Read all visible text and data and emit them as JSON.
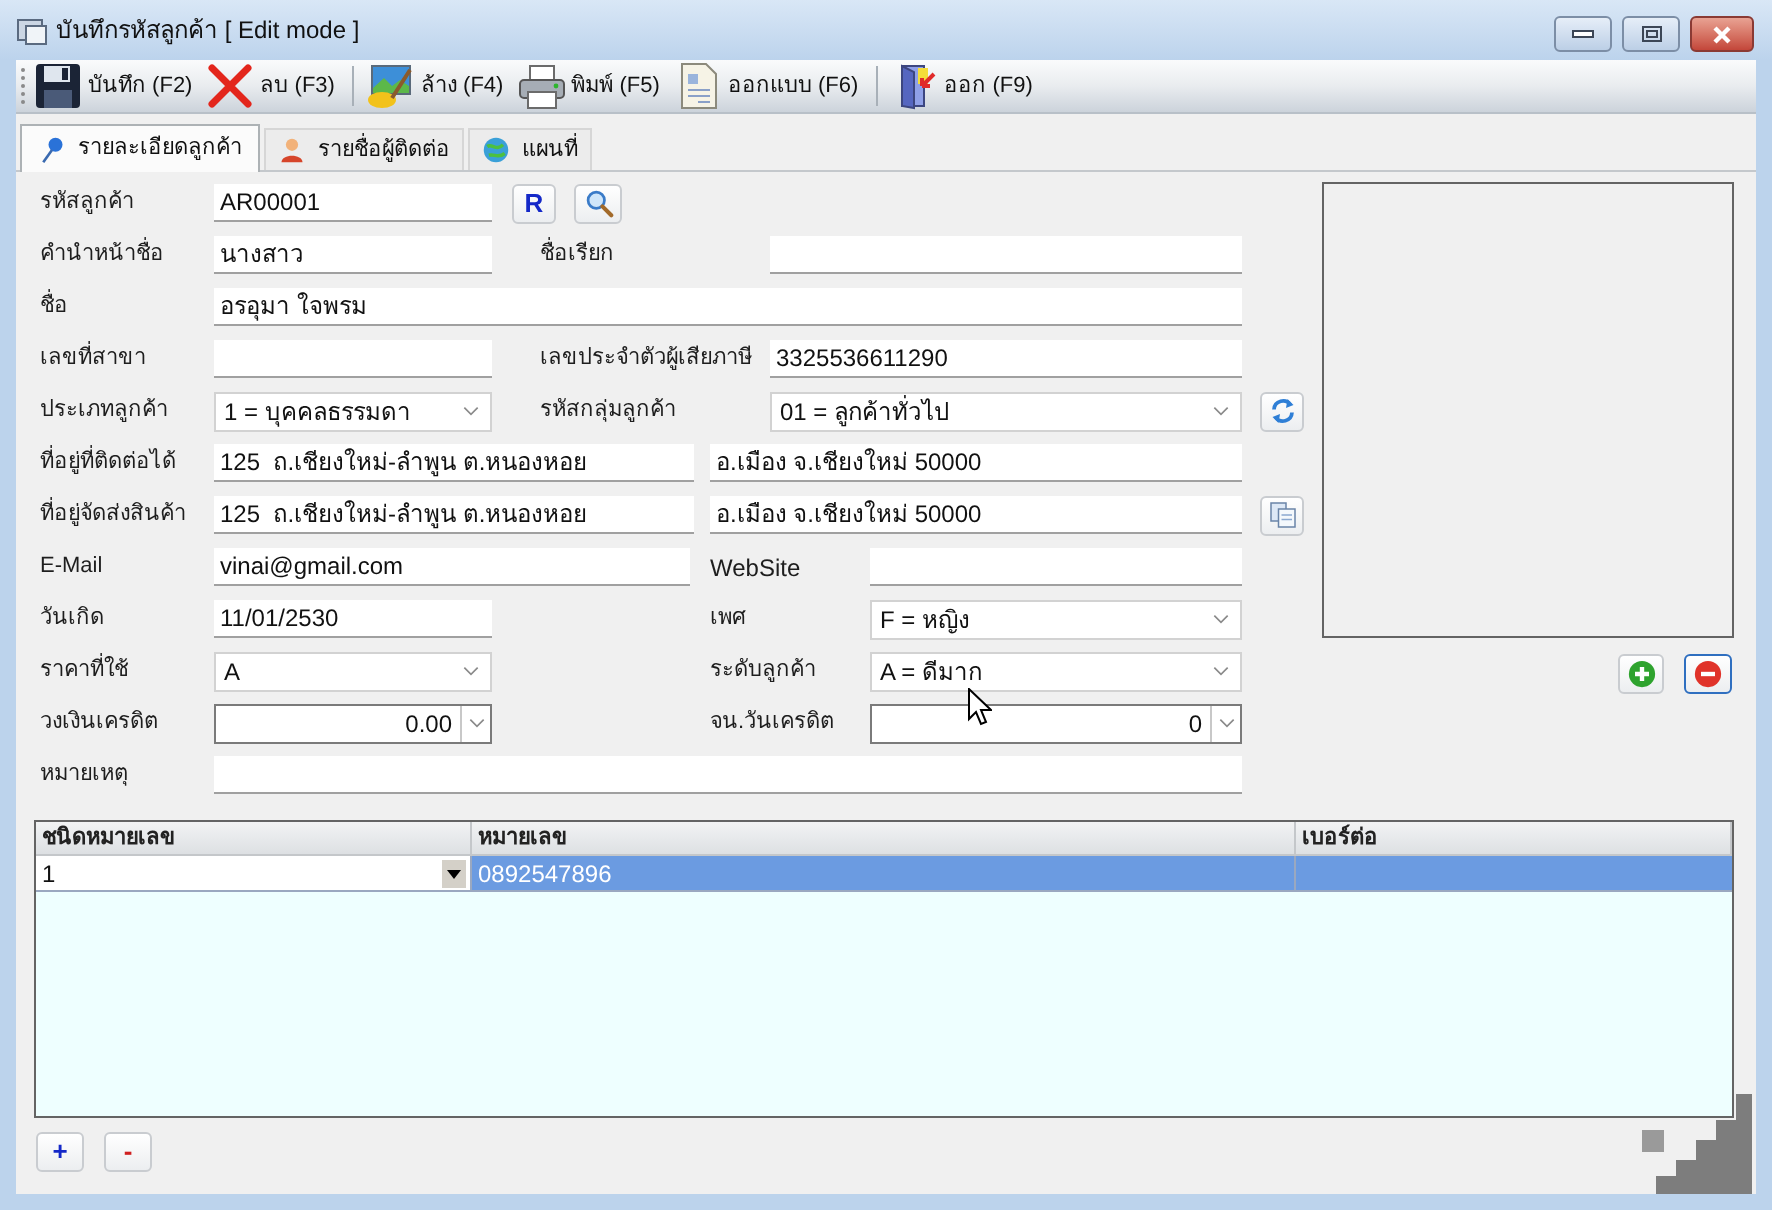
{
  "window": {
    "title": "บันทึกรหัสลูกค้า [ Edit mode ]"
  },
  "toolbar": {
    "groups": [
      [
        {
          "label": "บันทึก (F2)",
          "kind": "save"
        },
        {
          "label": "ลบ (F3)",
          "kind": "delete"
        }
      ],
      [
        {
          "label": "ล้าง (F4)",
          "kind": "clear"
        },
        {
          "label": "พิมพ์ (F5)",
          "kind": "print"
        },
        {
          "label": "ออกแบบ (F6)",
          "kind": "design"
        }
      ],
      [
        {
          "label": "ออก (F9)",
          "kind": "exit"
        }
      ]
    ]
  },
  "tabs": [
    {
      "label": "รายละเอียดลูกค้า",
      "kind": "detail",
      "selected": true
    },
    {
      "label": "รายชื่อผู้ติดต่อ",
      "kind": "contacts",
      "selected": false
    },
    {
      "label": "แผนที่",
      "kind": "map",
      "selected": false
    }
  ],
  "form": {
    "customer_code": {
      "label": "รหัสลูกค้า",
      "value": "AR00001",
      "button": "R"
    },
    "name_prefix": {
      "label": "คำนำหน้าชื่อ",
      "value": "นางสาว"
    },
    "nickname": {
      "label": "ชื่อเรียก"
    },
    "name": {
      "label": "ชื่อ",
      "value": "อรอุมา ใจพรม"
    },
    "branch_no": {
      "label": "เลขที่สาขา"
    },
    "tax_id": {
      "label": "เลขประจำตัวผู้เสียภาษี",
      "value": "3325536611290"
    },
    "customer_type": {
      "label": "ประเภทลูกค้า",
      "value": "1 = บุคคลธรรมดา"
    },
    "customer_group": {
      "label": "รหัสกลุ่มลูกค้า",
      "value": "01 = ลูกค้าทั่วไป"
    },
    "contact_address": {
      "label": "ที่อยู่ที่ติดต่อได้",
      "line_1": "125  ถ.เชียงใหม่-ลำพูน ต.หนองหอย",
      "line_2": "อ.เมือง จ.เชียงใหม่ 50000"
    },
    "shipping_address": {
      "label": "ที่อยู่จัดส่งสินค้า",
      "line_1": "125  ถ.เชียงใหม่-ลำพูน ต.หนองหอย",
      "line_2": "อ.เมือง จ.เชียงใหม่ 50000"
    },
    "email": {
      "label": "E-Mail",
      "value": "vinai@gmail.com"
    },
    "website": {
      "label": "WebSite"
    },
    "birth_date": {
      "label": "วันเกิด",
      "value": "11/01/2530"
    },
    "gender": {
      "label": "เพศ",
      "value": "F = หญิง"
    },
    "price_level": {
      "label": "ราคาที่ใช้",
      "value": "A"
    },
    "customer_grade": {
      "label": "ระดับลูกค้า",
      "value": "A = ดีมาก"
    },
    "credit_limit": {
      "label": "วงเงินเครดิต",
      "value": "0.00"
    },
    "credit_days": {
      "label": "จน.วันเครดิต",
      "value": "0"
    },
    "note": {
      "label": "หมายเหตุ"
    }
  },
  "phone_table": {
    "columns": [
      "ชนิดหมายเลข",
      "หมายเลข",
      "เบอร์ต่อ"
    ],
    "rows": [
      {
        "type": "1",
        "number": "0892547896",
        "selected": true
      }
    ]
  },
  "table_buttons": [
    "+",
    "-"
  ]
}
